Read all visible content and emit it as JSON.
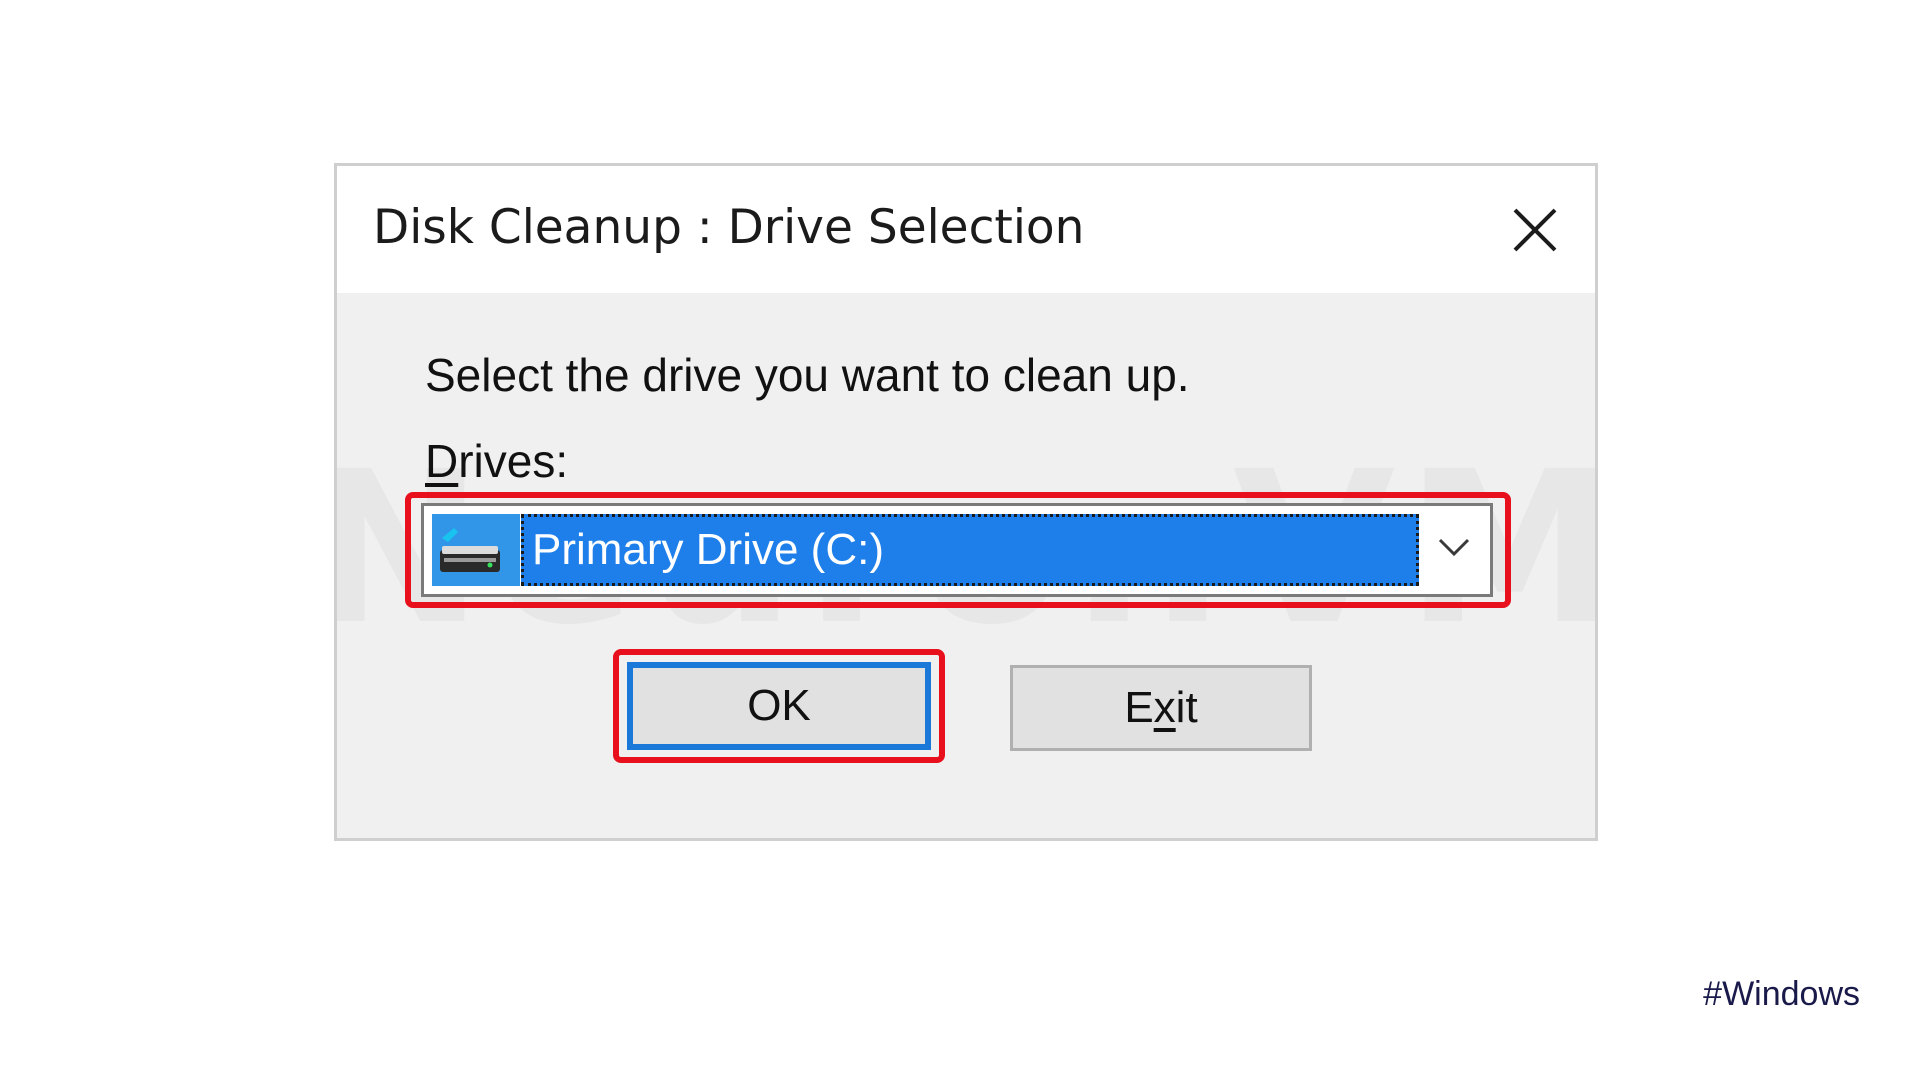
{
  "dialog": {
    "title": "Disk Cleanup : Drive Selection",
    "prompt": "Select the drive you want to clean up.",
    "drives_label_first": "D",
    "drives_label_rest": "rives:",
    "drive_selected": "Primary Drive (C:)",
    "ok_label": "OK",
    "exit_label_pre": "E",
    "exit_label_underlined": "x",
    "exit_label_post": "it"
  },
  "icons": {
    "close": "close-icon",
    "drive": "hard-drive-icon",
    "dropdown": "chevron-down-icon"
  },
  "colors": {
    "highlight_frame": "#e8101c",
    "selection_blue": "#1f7fea",
    "ok_border": "#1a78d8",
    "dialog_body": "#f0f0f0"
  },
  "watermark": "NeuronVM",
  "hashtag": "#Windows"
}
